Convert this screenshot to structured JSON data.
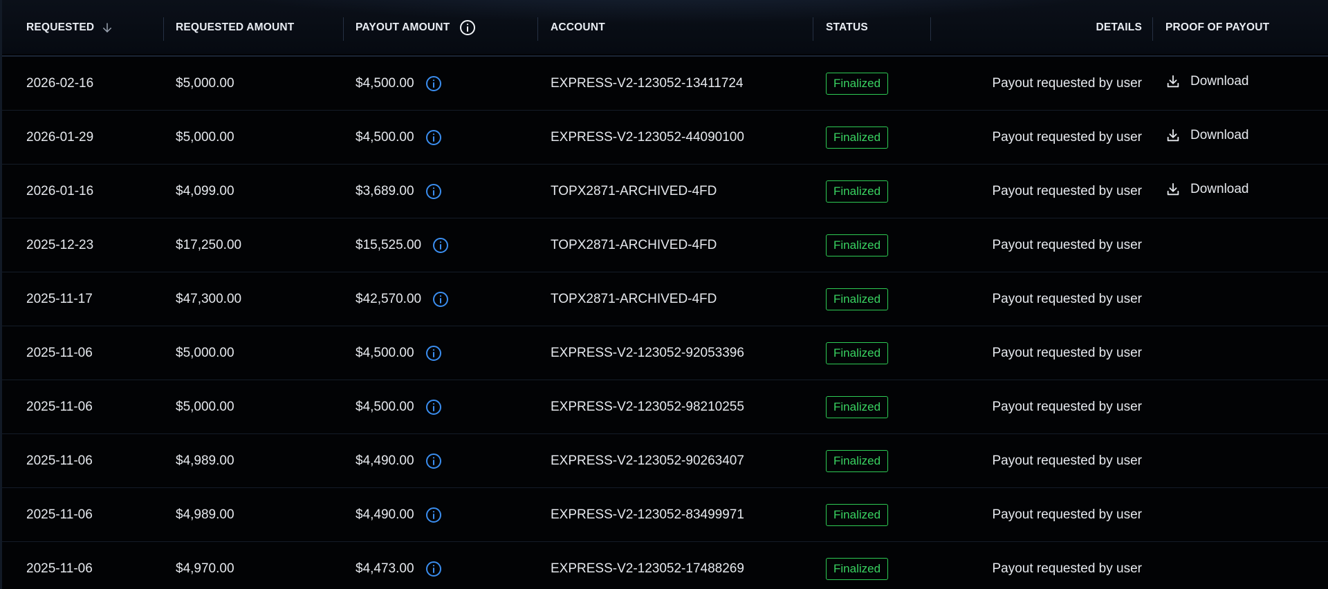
{
  "table": {
    "headers": {
      "requested": "REQUESTED",
      "requested_amount": "REQUESTED AMOUNT",
      "payout_amount": "PAYOUT AMOUNT",
      "account": "ACCOUNT",
      "status": "STATUS",
      "details": "DETAILS",
      "proof": "PROOF OF PAYOUT"
    },
    "icons": {
      "sort": "arrow-down-icon",
      "payout_header_info": "info-icon",
      "payout_row_info": "info-icon",
      "download": "download-icon"
    },
    "colors": {
      "finalized": "#39d361",
      "info_blue": "#3b8ef0",
      "text": "#e6e9ee"
    },
    "rows": [
      {
        "date": "2026-02-16",
        "requested_amount": "$5,000.00",
        "payout_amount": "$4,500.00",
        "account": "EXPRESS-V2-123052-13411724",
        "status": "Finalized",
        "details": "Payout requested by user",
        "proof": "Download"
      },
      {
        "date": "2026-01-29",
        "requested_amount": "$5,000.00",
        "payout_amount": "$4,500.00",
        "account": "EXPRESS-V2-123052-44090100",
        "status": "Finalized",
        "details": "Payout requested by user",
        "proof": "Download"
      },
      {
        "date": "2026-01-16",
        "requested_amount": "$4,099.00",
        "payout_amount": "$3,689.00",
        "account": "TOPX2871-ARCHIVED-4FD",
        "status": "Finalized",
        "details": "Payout requested by user",
        "proof": "Download"
      },
      {
        "date": "2025-12-23",
        "requested_amount": "$17,250.00",
        "payout_amount": "$15,525.00",
        "account": "TOPX2871-ARCHIVED-4FD",
        "status": "Finalized",
        "details": "Payout requested by user",
        "proof": ""
      },
      {
        "date": "2025-11-17",
        "requested_amount": "$47,300.00",
        "payout_amount": "$42,570.00",
        "account": "TOPX2871-ARCHIVED-4FD",
        "status": "Finalized",
        "details": "Payout requested by user",
        "proof": ""
      },
      {
        "date": "2025-11-06",
        "requested_amount": "$5,000.00",
        "payout_amount": "$4,500.00",
        "account": "EXPRESS-V2-123052-92053396",
        "status": "Finalized",
        "details": "Payout requested by user",
        "proof": ""
      },
      {
        "date": "2025-11-06",
        "requested_amount": "$5,000.00",
        "payout_amount": "$4,500.00",
        "account": "EXPRESS-V2-123052-98210255",
        "status": "Finalized",
        "details": "Payout requested by user",
        "proof": ""
      },
      {
        "date": "2025-11-06",
        "requested_amount": "$4,989.00",
        "payout_amount": "$4,490.00",
        "account": "EXPRESS-V2-123052-90263407",
        "status": "Finalized",
        "details": "Payout requested by user",
        "proof": ""
      },
      {
        "date": "2025-11-06",
        "requested_amount": "$4,989.00",
        "payout_amount": "$4,490.00",
        "account": "EXPRESS-V2-123052-83499971",
        "status": "Finalized",
        "details": "Payout requested by user",
        "proof": ""
      },
      {
        "date": "2025-11-06",
        "requested_amount": "$4,970.00",
        "payout_amount": "$4,473.00",
        "account": "EXPRESS-V2-123052-17488269",
        "status": "Finalized",
        "details": "Payout requested by user",
        "proof": ""
      }
    ]
  }
}
